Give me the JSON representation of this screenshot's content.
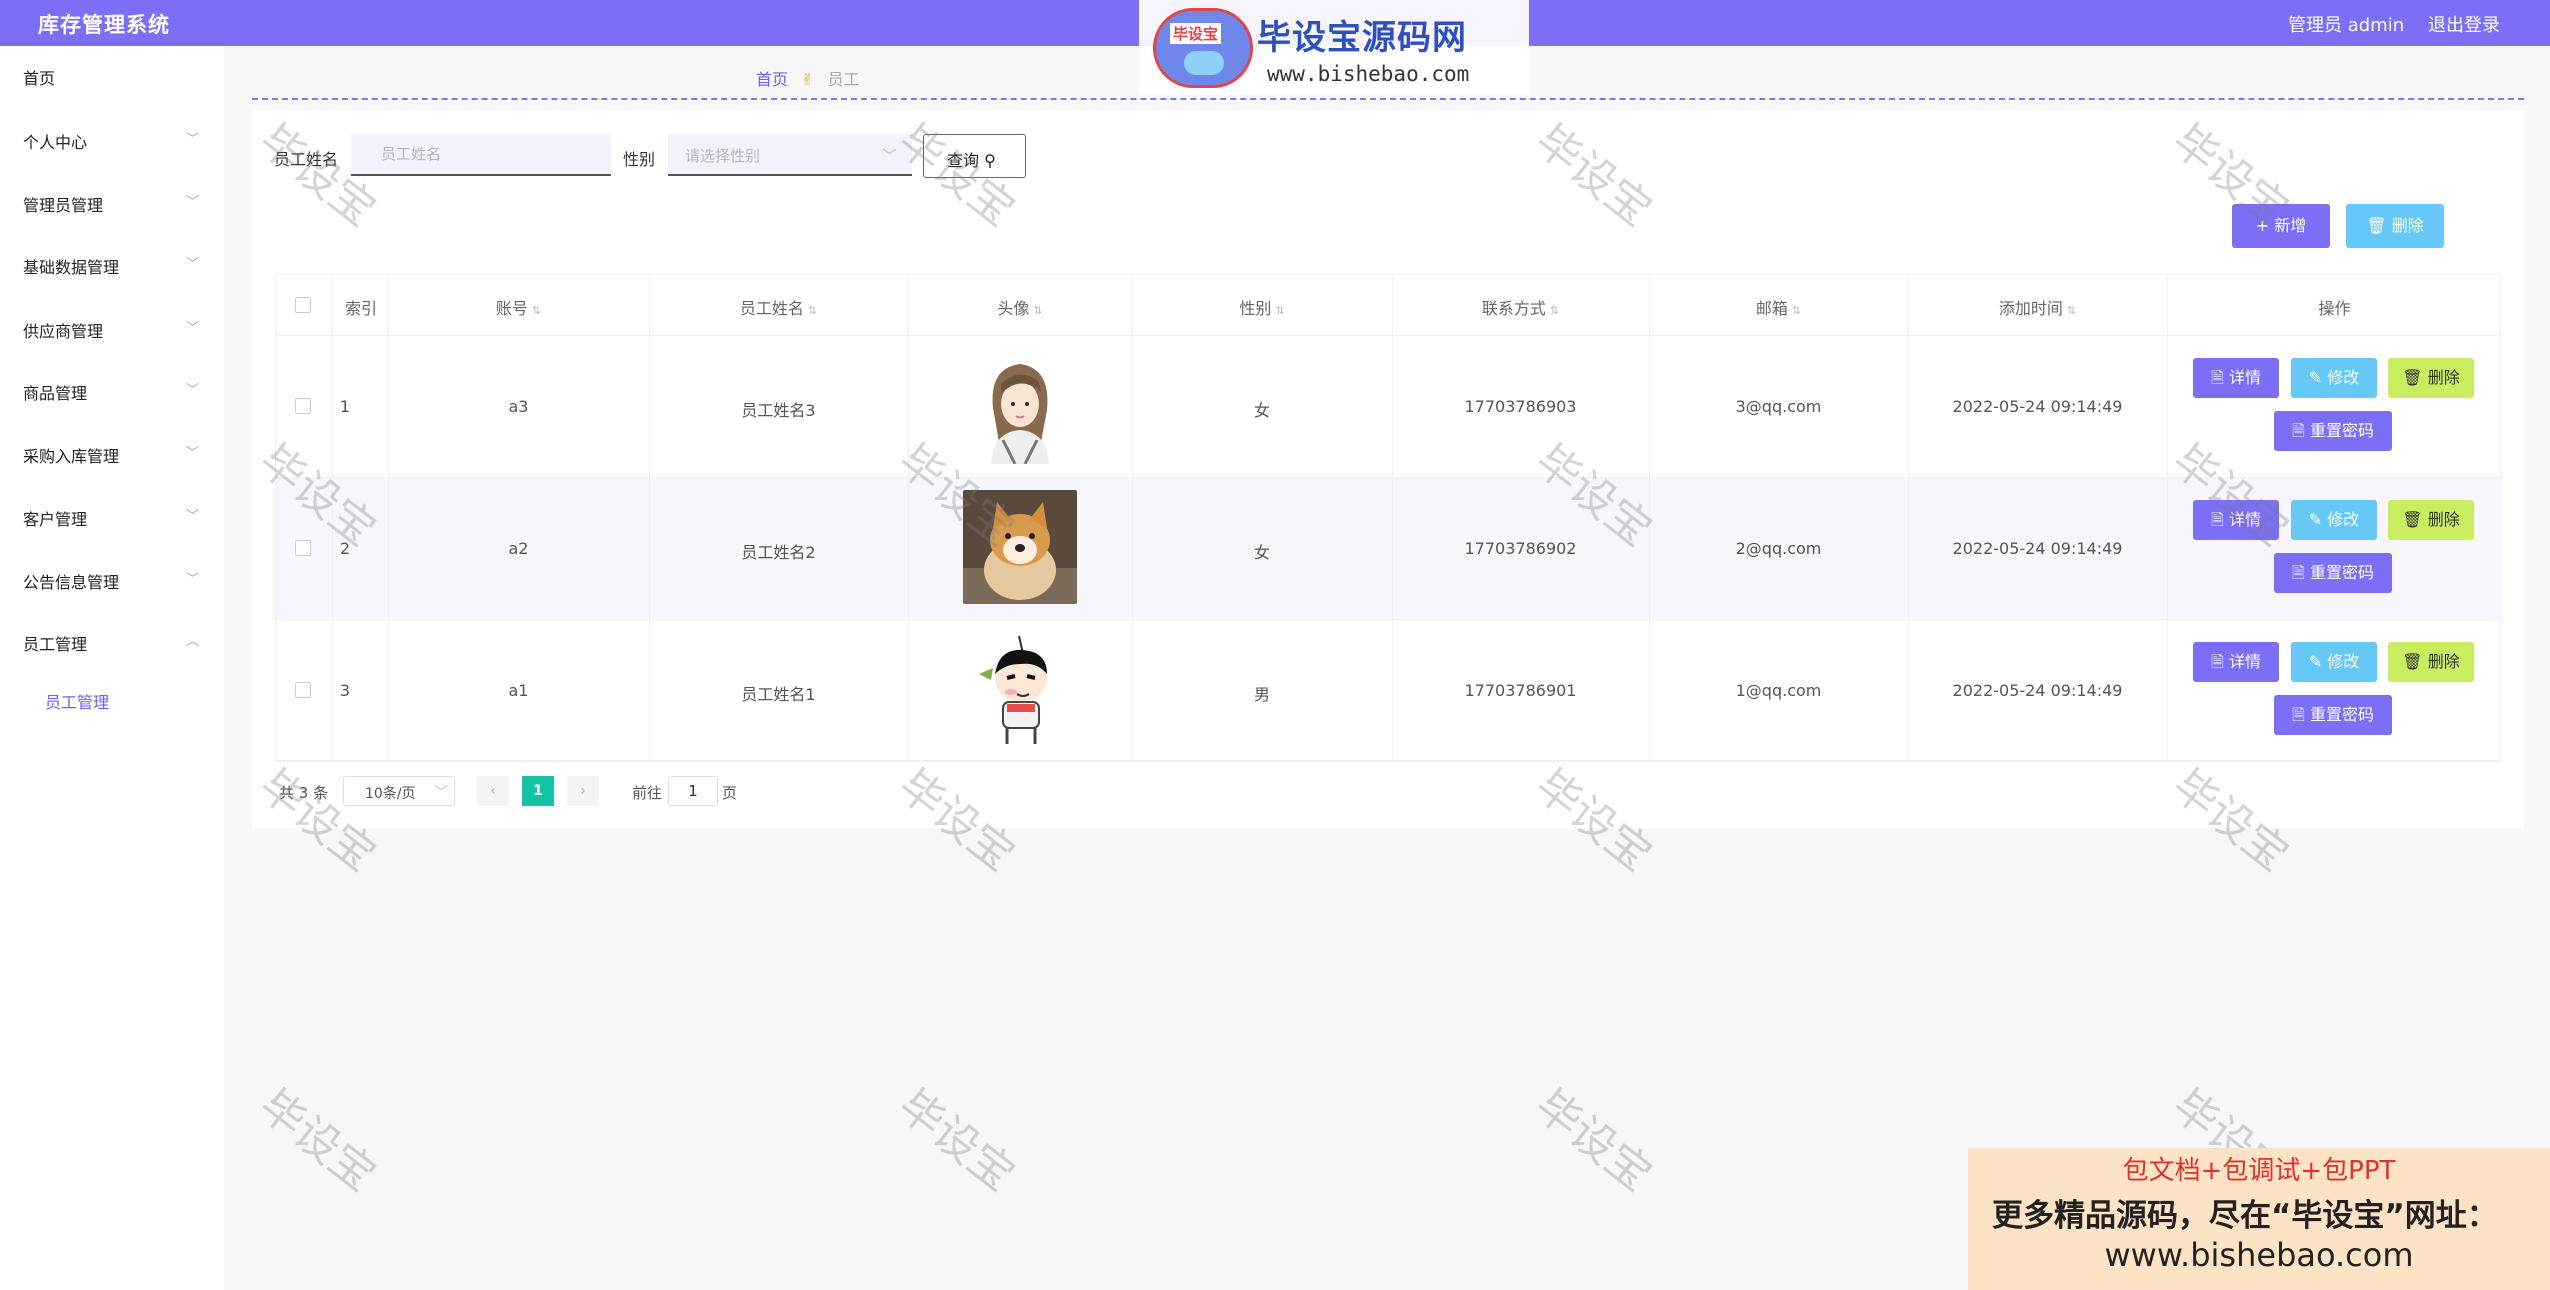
{
  "header": {
    "title": "库存管理系统",
    "admin_label": "管理员 admin",
    "logout": "退出登录"
  },
  "sidebar": {
    "items": [
      {
        "label": "首页"
      },
      {
        "label": "个人中心"
      },
      {
        "label": "管理员管理"
      },
      {
        "label": "基础数据管理"
      },
      {
        "label": "供应商管理"
      },
      {
        "label": "商品管理"
      },
      {
        "label": "采购入库管理"
      },
      {
        "label": "客户管理"
      },
      {
        "label": "公告信息管理"
      },
      {
        "label": "员工管理"
      }
    ],
    "sub_item": "员工管理"
  },
  "breadcrumb": {
    "home": "首页",
    "current": "员工"
  },
  "search": {
    "name_label": "员工姓名",
    "name_placeholder": "员工姓名",
    "gender_label": "性别",
    "gender_placeholder": "请选择性别",
    "query_label": "查询"
  },
  "toolbar": {
    "add_label": "+ 新增",
    "delete_label": "删除"
  },
  "table": {
    "columns": [
      "索引",
      "账号",
      "员工姓名",
      "头像",
      "性别",
      "联系方式",
      "邮箱",
      "添加时间",
      "操作"
    ],
    "rows": [
      {
        "index": "1",
        "account": "a3",
        "name": "员工姓名3",
        "gender": "女",
        "phone": "17703786903",
        "email": "3@qq.com",
        "time": "2022-05-24 09:14:49"
      },
      {
        "index": "2",
        "account": "a2",
        "name": "员工姓名2",
        "gender": "女",
        "phone": "17703786902",
        "email": "2@qq.com",
        "time": "2022-05-24 09:14:49"
      },
      {
        "index": "3",
        "account": "a1",
        "name": "员工姓名1",
        "gender": "男",
        "phone": "17703786901",
        "email": "1@qq.com",
        "time": "2022-05-24 09:14:49"
      }
    ],
    "actions": {
      "detail": "详情",
      "edit": "修改",
      "remove": "删除",
      "reset": "重置密码"
    }
  },
  "pagination": {
    "total": "共 3 条",
    "page_size": "10条/页",
    "current_page": "1",
    "goto_label": "前往",
    "goto_value": "1",
    "page_unit": "页"
  },
  "watermark": "毕设宝",
  "logo": {
    "badge": "毕设宝",
    "title": "毕设宝源码网",
    "url": "www.bishebao.com"
  },
  "ad": {
    "line1": "包文档+包调试+包PPT",
    "line2": "更多精品源码，尽在“毕设宝”网址：",
    "line3": "www.bishebao.com"
  },
  "colors": {
    "primary": "#7b6ff5",
    "info": "#65c8f6",
    "lime": "#c8ee5f",
    "pager_active": "#13c3a3"
  }
}
